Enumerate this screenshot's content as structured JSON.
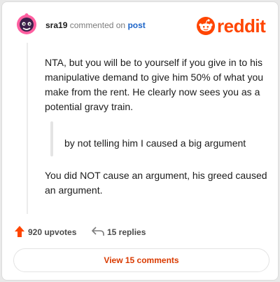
{
  "comment": {
    "username": "sra19",
    "commented_text": "commented on",
    "post_link": "post",
    "paragraph1": "NTA, but you will be to yourself if you give in to his manipulative demand to give him 50% of what you make from the rent. He clearly now sees you as a potential gravy train.",
    "quote": "by not telling him I caused a big argument",
    "paragraph2": "You did NOT cause an argument, his greed caused an argument."
  },
  "brand": {
    "wordmark": "reddit",
    "color": "#ff4500"
  },
  "actions": {
    "upvotes": "920 upvotes",
    "replies": "15 replies",
    "upvote_icon": "upvote-arrow-icon",
    "reply_icon": "reply-arrow-icon"
  },
  "footer": {
    "view_comments": "View 15 comments"
  }
}
